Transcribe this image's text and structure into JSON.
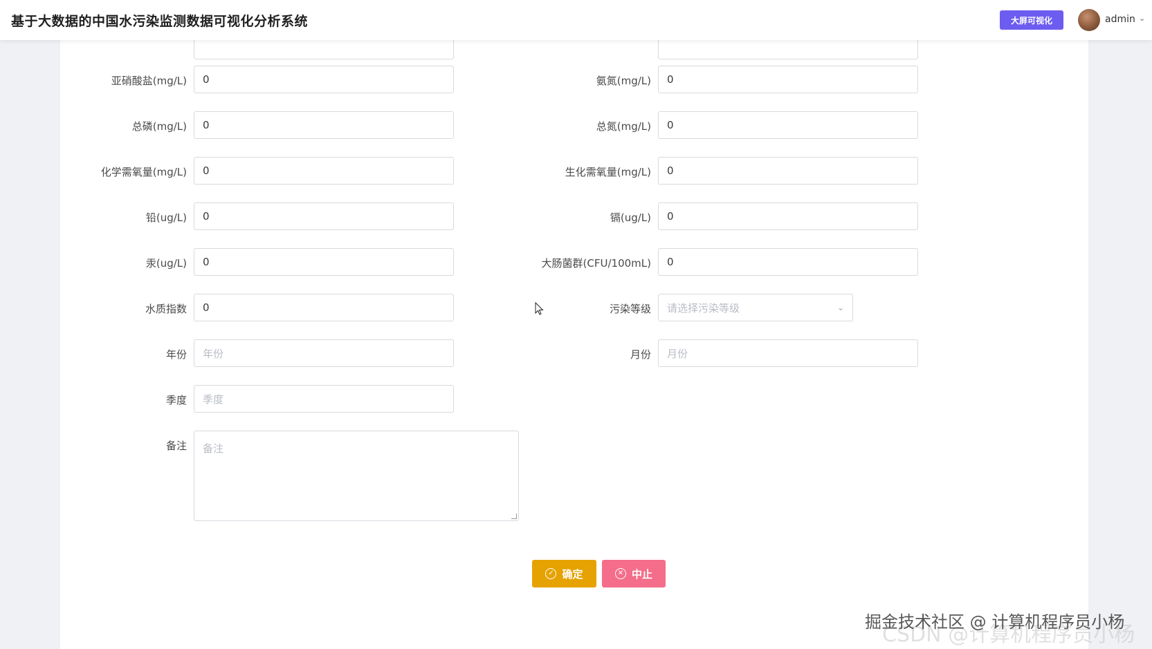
{
  "app": {
    "title": "基于大数据的中国水污染监测数据可视化分析系统",
    "bigscreen_button": "大屏可视化",
    "user_name": "admin",
    "accent_color": "#6d5cf0"
  },
  "form": {
    "nitrite": {
      "label": "亚硝酸盐(mg/L)",
      "value": "0"
    },
    "ammonia": {
      "label": "氨氮(mg/L)",
      "value": "0"
    },
    "total_phosphorus": {
      "label": "总磷(mg/L)",
      "value": "0"
    },
    "total_nitrogen": {
      "label": "总氮(mg/L)",
      "value": "0"
    },
    "cod": {
      "label": "化学需氧量(mg/L)",
      "value": "0"
    },
    "bod": {
      "label": "生化需氧量(mg/L)",
      "value": "0"
    },
    "lead": {
      "label": "铅(ug/L)",
      "value": "0"
    },
    "cadmium": {
      "label": "镉(ug/L)",
      "value": "0"
    },
    "mercury": {
      "label": "汞(ug/L)",
      "value": "0"
    },
    "coliform": {
      "label": "大肠菌群(CFU/100mL)",
      "value": "0"
    },
    "water_quality_index": {
      "label": "水质指数",
      "value": "0"
    },
    "pollution_level": {
      "label": "污染等级",
      "placeholder": "请选择污染等级"
    },
    "year": {
      "label": "年份",
      "placeholder": "年份"
    },
    "month": {
      "label": "月份",
      "placeholder": "月份"
    },
    "quarter": {
      "label": "季度",
      "placeholder": "季度"
    },
    "remark": {
      "label": "备注",
      "placeholder": "备注"
    }
  },
  "buttons": {
    "confirm": "确定",
    "abort": "中止",
    "confirm_color": "#e6a200",
    "abort_color": "#f46d8a"
  },
  "watermark": "掘金技术社区 @ 计算机程序员小杨",
  "watermark_back": "CSDN @计算机程序员小杨"
}
